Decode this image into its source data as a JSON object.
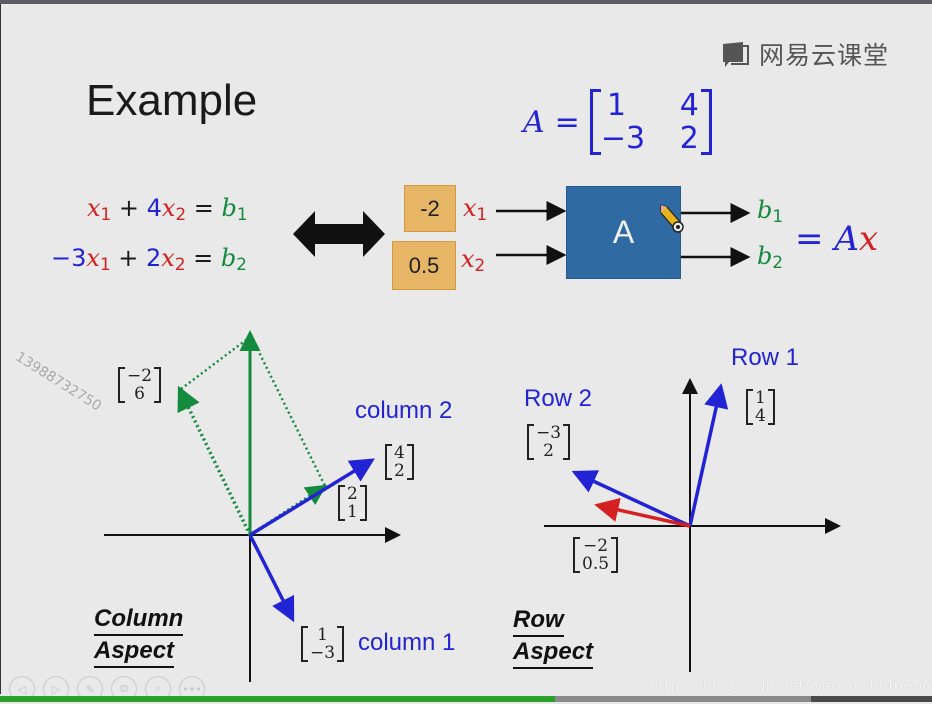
{
  "brand": {
    "logo_text": "网易云课堂",
    "icon": "book-chat-icon"
  },
  "slide": {
    "title": "Example",
    "equations": [
      {
        "coef1": "",
        "var1": "x",
        "sub1": "1",
        "op": "+",
        "coef2": "4",
        "var2": "x",
        "sub2": "2",
        "eq": "=",
        "rhs": "b",
        "rhs_sub": "1"
      },
      {
        "coef1": "−3",
        "var1": "x",
        "sub1": "1",
        "op": "+",
        "coef2": "2",
        "var2": "x",
        "sub2": "2",
        "eq": "=",
        "rhs": "b",
        "rhs_sub": "2"
      }
    ],
    "double_arrow_icon": "double-arrow-icon",
    "matrix": {
      "name": "A",
      "eq": "=",
      "rows": [
        [
          "1",
          "4"
        ],
        [
          "−3",
          "2"
        ]
      ]
    },
    "machine": {
      "inputs": [
        {
          "value": "-2",
          "var": "x",
          "sub": "1"
        },
        {
          "value": "0.5",
          "var": "x",
          "sub": "2"
        }
      ],
      "box_label": "A",
      "outputs": [
        {
          "var": "b",
          "sub": "1"
        },
        {
          "var": "b",
          "sub": "2"
        }
      ],
      "result": {
        "eq": "=",
        "A": "A",
        "x": "x"
      },
      "cursor_icon": "pencil-cursor-icon"
    },
    "column_aspect": {
      "label_line1": "Column",
      "label_line2": "Aspect",
      "vectors": [
        {
          "name": "column 1",
          "components": [
            "1",
            "−3"
          ],
          "color": "#2323d6"
        },
        {
          "name": "column 2",
          "components": [
            "4",
            "2"
          ],
          "color": "#2323d6"
        },
        {
          "name": "scaled column 2",
          "components": [
            "2",
            "1"
          ],
          "color": "#138a3c"
        },
        {
          "name": "scaled column 1",
          "components": [
            "−2",
            "6"
          ],
          "color": "#138a3c"
        },
        {
          "name": "result",
          "components": [
            "0",
            "7"
          ],
          "color": "#138a3c"
        }
      ],
      "vec_labels": {
        "c2": [
          "4",
          "2"
        ],
        "half": [
          "2",
          "1"
        ],
        "neg2c1": [
          "−2",
          "6"
        ],
        "c1": [
          "1",
          "−3"
        ]
      },
      "col1_label": "column 1",
      "col2_label": "column 2"
    },
    "row_aspect": {
      "label_line1": "Row",
      "label_line2": "Aspect",
      "row1_label": "Row 1",
      "row2_label": "Row 2",
      "row1_vec": [
        "1",
        "4"
      ],
      "row2_vec": [
        "−3",
        "2"
      ],
      "x_vec": [
        "−2",
        "0.5"
      ],
      "colors": {
        "rows": "#2323d6",
        "x": "#d42020"
      }
    }
  },
  "watermarks": {
    "phone": "13988732750",
    "url": "https://blog.csdn.net/weixin_44466903"
  },
  "player": {
    "controls": [
      {
        "name": "prev-icon",
        "glyph": "◁"
      },
      {
        "name": "next-icon",
        "glyph": "▷"
      },
      {
        "name": "pen-icon",
        "glyph": "✎"
      },
      {
        "name": "slides-icon",
        "glyph": "⧉"
      },
      {
        "name": "zoom-icon",
        "glyph": "⌕"
      },
      {
        "name": "more-icon",
        "glyph": "•••"
      }
    ],
    "progress_played": 0.595,
    "progress_buffered": 0.87,
    "colors": {
      "played": "#2aa02a",
      "buffered": "#8a8a8a",
      "track": "#4a4a4a"
    }
  }
}
